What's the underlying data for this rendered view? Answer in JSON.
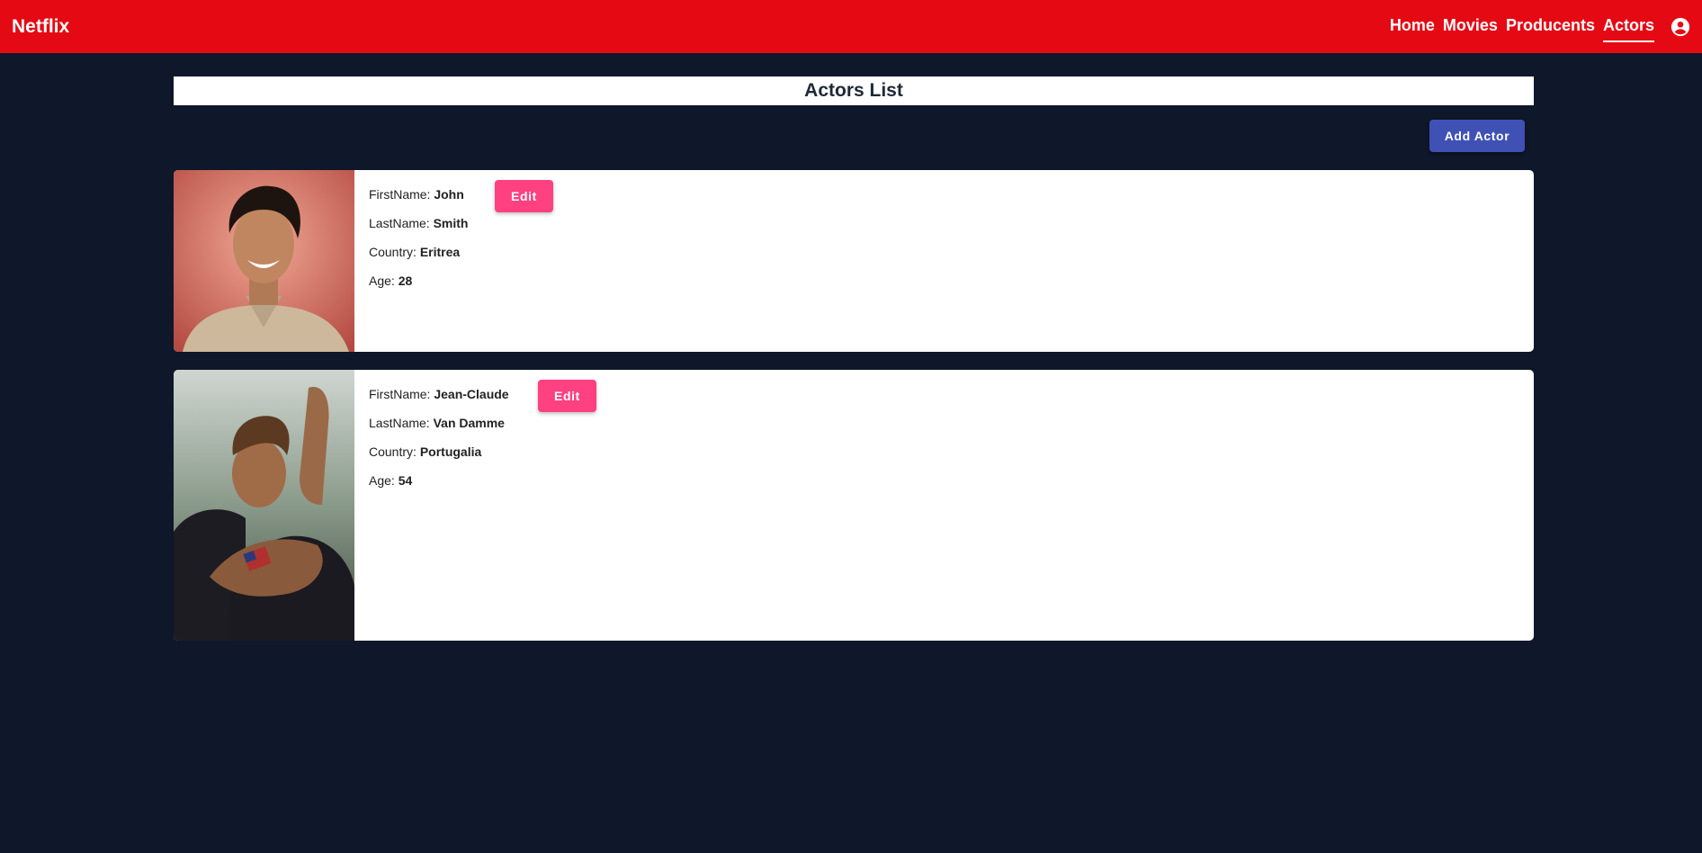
{
  "header": {
    "brand": "Netflix",
    "nav": [
      "Home",
      "Movies",
      "Producents",
      "Actors"
    ],
    "active_nav": "Actors",
    "account_icon": "account-circle-icon"
  },
  "page": {
    "title": "Actors List",
    "add_button": "Add Actor"
  },
  "labels": {
    "first_name": "FirstName: ",
    "last_name": "LastName: ",
    "country": "Country: ",
    "age": "Age: ",
    "edit": "Edit"
  },
  "actors": [
    {
      "first_name": "John",
      "last_name": "Smith",
      "country": "Eritrea",
      "age": "28"
    },
    {
      "first_name": "Jean-Claude",
      "last_name": "Van Damme",
      "country": "Portugalia",
      "age": "54"
    }
  ],
  "colors": {
    "header": "#e50914",
    "background": "#0f172a",
    "add_button": "#3f51b5",
    "edit_button": "#ff4081"
  }
}
